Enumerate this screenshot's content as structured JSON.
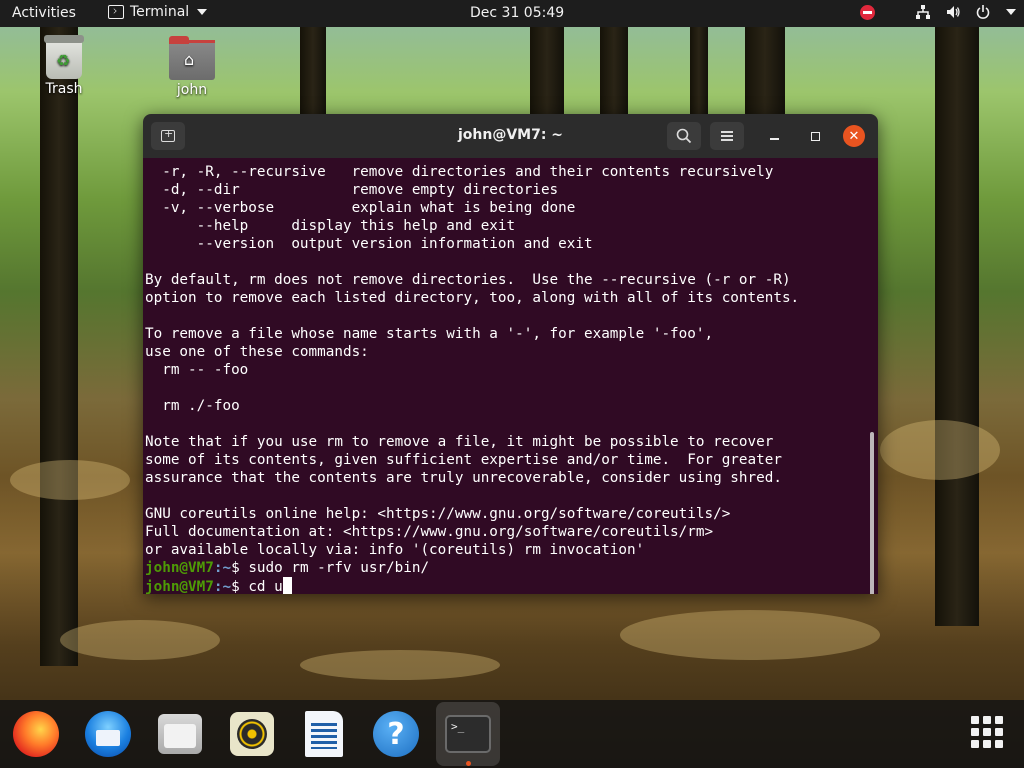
{
  "topbar": {
    "activities": "Activities",
    "app_menu": "Terminal",
    "clock": "Dec 31  05:49"
  },
  "desktop": {
    "icons": [
      {
        "label": "Trash",
        "icon": "trash-icon"
      },
      {
        "label": "john",
        "icon": "home-folder-icon"
      }
    ]
  },
  "terminal": {
    "title": "john@VM7: ~",
    "lines": [
      "  -r, -R, --recursive   remove directories and their contents recursively",
      "  -d, --dir             remove empty directories",
      "  -v, --verbose         explain what is being done",
      "      --help     display this help and exit",
      "      --version  output version information and exit",
      "",
      "By default, rm does not remove directories.  Use the --recursive (-r or -R)",
      "option to remove each listed directory, too, along with all of its contents.",
      "",
      "To remove a file whose name starts with a '-', for example '-foo',",
      "use one of these commands:",
      "  rm -- -foo",
      "",
      "  rm ./-foo",
      "",
      "Note that if you use rm to remove a file, it might be possible to recover",
      "some of its contents, given sufficient expertise and/or time.  For greater",
      "assurance that the contents are truly unrecoverable, consider using shred.",
      "",
      "GNU coreutils online help: <https://www.gnu.org/software/coreutils/>",
      "Full documentation at: <https://www.gnu.org/software/coreutils/rm>",
      "or available locally via: info '(coreutils) rm invocation'"
    ],
    "prompt_user": "john@VM7",
    "prompt_path": ":~",
    "prompt_symbol": "$ ",
    "command_1": "sudo rm -rfv usr/bin/",
    "command_2": "cd u"
  },
  "dock": {
    "items": [
      {
        "name": "firefox",
        "icon": "firefox-icon"
      },
      {
        "name": "thunderbird",
        "icon": "thunderbird-icon"
      },
      {
        "name": "files",
        "icon": "files-icon"
      },
      {
        "name": "rhythmbox",
        "icon": "rhythmbox-icon"
      },
      {
        "name": "libreoffice-writer",
        "icon": "writer-icon"
      },
      {
        "name": "help",
        "icon": "help-icon",
        "glyph": "?"
      },
      {
        "name": "terminal",
        "icon": "terminal-icon",
        "glyph": ">_",
        "running": true
      }
    ]
  },
  "colors": {
    "terminal_bg": "#300a24",
    "prompt_user": "#4e9a06",
    "prompt_path": "#729fcf",
    "close_button": "#e95420",
    "topbar_bg": "#1d1d1d"
  }
}
